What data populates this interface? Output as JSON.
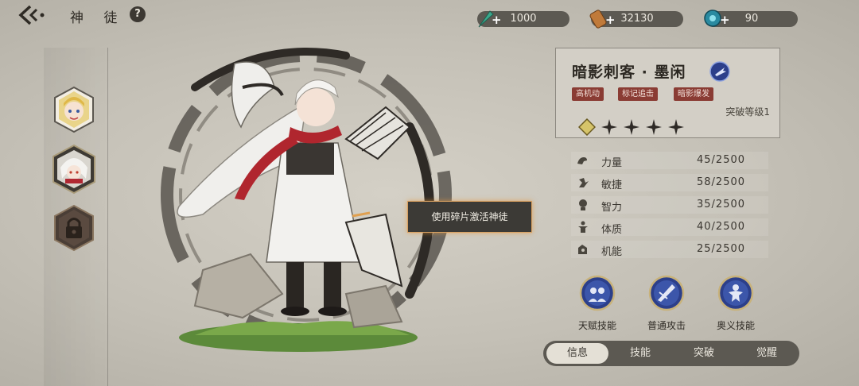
{
  "header": {
    "title": "神 徒",
    "help_label": "?"
  },
  "resources": [
    {
      "icon": "feather-icon",
      "value": "1000",
      "plus": "+"
    },
    {
      "icon": "scroll-icon",
      "value": "32130",
      "plus": "+"
    },
    {
      "icon": "gem-icon",
      "value": "90",
      "plus": "+"
    }
  ],
  "character_list": [
    {
      "name": "character-slot-1",
      "icon": "portrait-blonde"
    },
    {
      "name": "character-slot-2",
      "icon": "portrait-white-hair",
      "selected": true
    },
    {
      "name": "character-slot-3",
      "icon": "lock-icon"
    }
  ],
  "tooltip": "使用碎片激活神徒",
  "hero": {
    "name": "暗影刺客 · 墨闲",
    "class_icon": "assassin-class-icon",
    "tags": [
      "高机动",
      "标记追击",
      "暗影爆发"
    ],
    "rank": "突破等级1",
    "stars_total": 5,
    "stars_filled": 1
  },
  "stats": [
    {
      "icon": "strength-icon",
      "label": "力量",
      "value": "45/2500"
    },
    {
      "icon": "agility-icon",
      "label": "敏捷",
      "value": "58/2500"
    },
    {
      "icon": "intellect-icon",
      "label": "智力",
      "value": "35/2500"
    },
    {
      "icon": "constitution-icon",
      "label": "体质",
      "value": "40/2500"
    },
    {
      "icon": "mechanic-icon",
      "label": "机能",
      "value": "25/2500"
    }
  ],
  "skills": [
    {
      "icon": "talent-skill-icon",
      "label": "天赋技能"
    },
    {
      "icon": "normal-attack-icon",
      "label": "普通攻击"
    },
    {
      "icon": "ultimate-skill-icon",
      "label": "奥义技能"
    }
  ],
  "tabs": [
    {
      "label": "信息",
      "active": true
    },
    {
      "label": "技能"
    },
    {
      "label": "突破"
    },
    {
      "label": "觉醒"
    }
  ],
  "colors": {
    "background": "#c8c4ba",
    "tag": "#8a3c34",
    "tooltip_border": "#d8a060",
    "skill_icon": "#2c3f8a"
  }
}
